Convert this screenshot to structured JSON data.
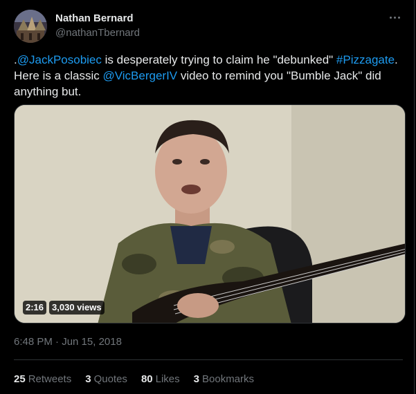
{
  "author": {
    "display_name": "Nathan Bernard",
    "handle": "@nathanTbernard"
  },
  "tweet": {
    "text_parts": [
      {
        "t": ".",
        "link": false
      },
      {
        "t": "@JackPosobiec",
        "link": true
      },
      {
        "t": " is desperately trying to claim he \"debunked\" ",
        "link": false
      },
      {
        "t": "#Pizzagate",
        "link": true
      },
      {
        "t": ". Here is a classic ",
        "link": false
      },
      {
        "t": "@VicBergerIV",
        "link": true
      },
      {
        "t": " video to remind you \"Bumble Jack\" did anything but.",
        "link": false
      }
    ]
  },
  "video": {
    "duration": "2:16",
    "views": "3,030 views"
  },
  "timestamp": "6:48 PM · Jun 15, 2018",
  "stats": {
    "retweets_count": "25",
    "retweets_label": "Retweets",
    "quotes_count": "3",
    "quotes_label": "Quotes",
    "likes_count": "80",
    "likes_label": "Likes",
    "bookmarks_count": "3",
    "bookmarks_label": "Bookmarks"
  },
  "colors": {
    "link": "#1d9bf0",
    "muted": "#71767b",
    "text": "#e7e9ea",
    "background": "#000000"
  },
  "icons": {
    "more": "more-dots-icon"
  }
}
